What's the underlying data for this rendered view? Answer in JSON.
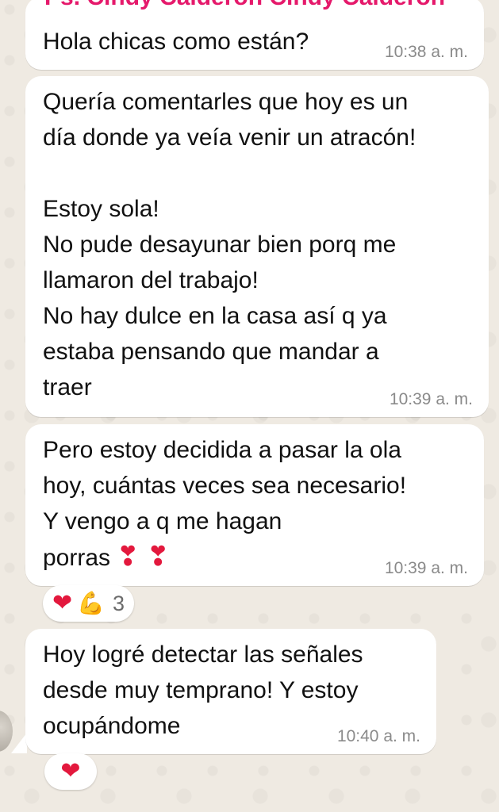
{
  "colors": {
    "background": "#EFEAE2",
    "bubble": "#FFFFFF",
    "sender_name": "#E5196B",
    "timestamp": "#8A8A8A",
    "heart": "#E3183D"
  },
  "messages": [
    {
      "sender": "Ps. Cindy Calderón Cindy Calderón",
      "text": "Hola chicas como están?",
      "time": "10:38 a. m."
    },
    {
      "text": "Quería comentarles que hoy es un\ndía donde ya veía venir un atracón!\n\nEstoy sola!\nNo pude desayunar bien porq me\nllamaron del trabajo!\nNo hay dulce en la casa así q ya\nestaba pensando que mandar a\ntraer",
      "time": "10:39 a. m."
    },
    {
      "text": "Pero estoy decidida a pasar la ola\nhoy, cuántas veces sea necesario!\nY vengo a q me hagan\nporras",
      "emoji": "❣ ❣",
      "time": "10:39 a. m.",
      "reactions": {
        "icons": [
          "heart-emoji",
          "flexed-biceps-emoji"
        ],
        "count": "3"
      }
    },
    {
      "text": "Hoy logré detectar las señales\ndesde muy temprano! Y estoy\nocupándome",
      "time": "10:40 a. m.",
      "reactions": {
        "icons": [
          "heart-emoji"
        ],
        "count": ""
      }
    }
  ]
}
